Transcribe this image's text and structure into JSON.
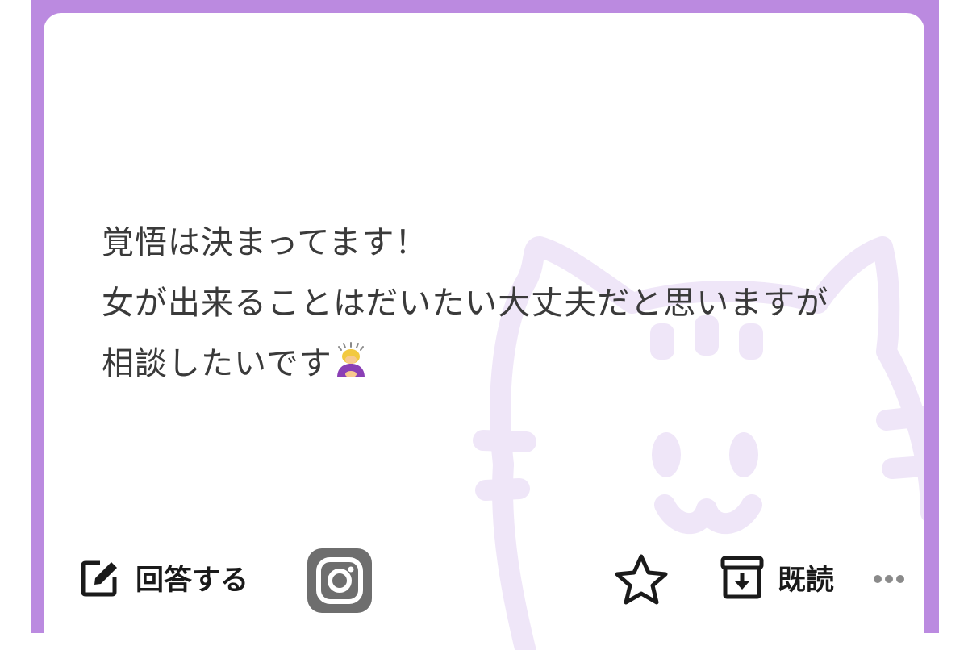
{
  "message": {
    "lines": [
      "覚悟は決まってます！",
      "女が出来ることはだいたい大丈夫だと思いますが",
      "相談したいです"
    ],
    "emoji_name": "woman-bowing-emoji"
  },
  "actions": {
    "reply_label": "回答する",
    "read_label": "既読",
    "reply_icon": "edit-icon",
    "instagram_icon": "instagram-icon",
    "favorite_icon": "star-icon",
    "read_icon": "archive-icon",
    "more_icon": "more-horizontal-icon"
  },
  "colors": {
    "frame": "#bb8ae0",
    "card": "#ffffff",
    "text": "#3a3a3a",
    "cat_watermark": "#efe6f8",
    "instagram_bg": "#6e6e6e"
  }
}
